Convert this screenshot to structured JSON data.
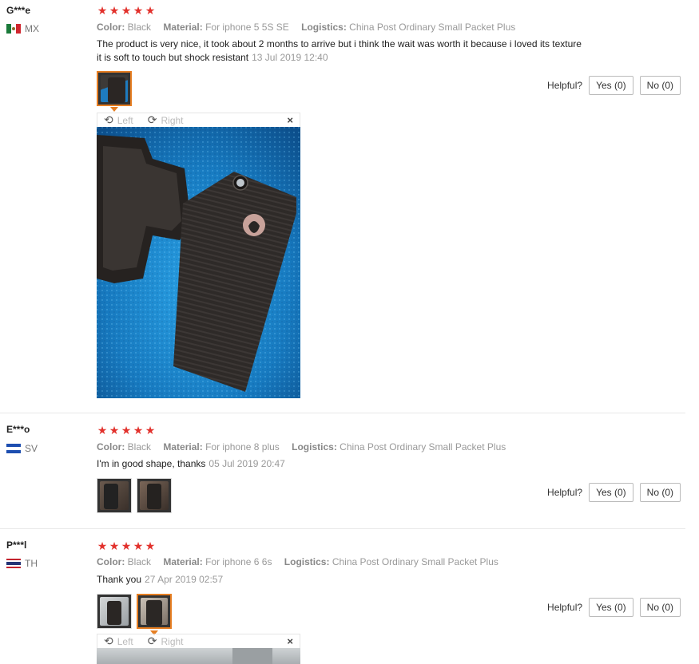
{
  "labels": {
    "color": "Color:",
    "material": "Material:",
    "logistics": "Logistics:",
    "helpful": "Helpful?",
    "rotate_left": "Left",
    "rotate_right": "Right",
    "close": "×"
  },
  "reviews": [
    {
      "user": "G***e",
      "country": "MX",
      "stars": [
        "★",
        "★",
        "★",
        "★",
        "★"
      ],
      "color": "Black",
      "material": "For iphone 5 5S SE",
      "logistics": "China Post Ordinary Small Packet Plus",
      "text_line1": "The product is very nice, it took about 2 months to arrive but i think the wait was worth it because i loved its texture",
      "text_line2": "it is soft to touch but shock resistant",
      "date": "13 Jul 2019 12:40",
      "yes": "Yes (0)",
      "no": "No (0)"
    },
    {
      "user": "E***o",
      "country": "SV",
      "stars": [
        "★",
        "★",
        "★",
        "★",
        "★"
      ],
      "color": "Black",
      "material": "For iphone 8 plus",
      "logistics": "China Post Ordinary Small Packet Plus",
      "text": "I'm in good shape, thanks",
      "date": "05 Jul 2019 20:47",
      "yes": "Yes (0)",
      "no": "No (0)"
    },
    {
      "user": "P***l",
      "country": "TH",
      "stars": [
        "★",
        "★",
        "★",
        "★",
        "★"
      ],
      "color": "Black",
      "material": "For iphone 6 6s",
      "logistics": "China Post Ordinary Small Packet Plus",
      "text": "Thank you",
      "date": "27 Apr 2019 02:57",
      "yes": "Yes (0)",
      "no": "No (0)"
    }
  ],
  "colors": {
    "star": "#e2312c",
    "active_thumb": "#e67e22",
    "glitter_blue": "#1a7fc4",
    "case_black": "#2a2624"
  }
}
